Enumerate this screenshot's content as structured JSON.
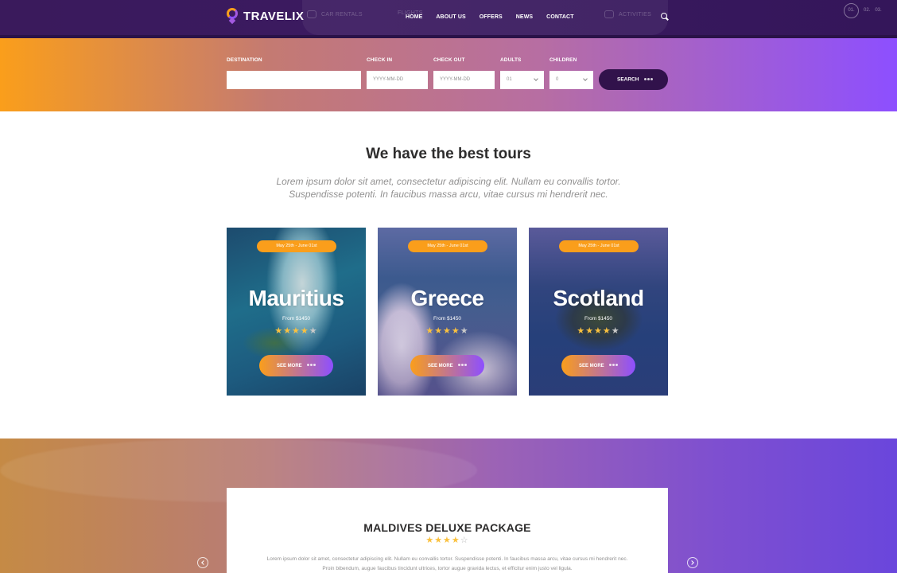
{
  "header": {
    "logo_text": "TRAVELIX",
    "ghost_tabs": [
      "CAR RENTALS",
      "FLIGHTS",
      "ACTIVITIES"
    ],
    "nav": [
      "HOME",
      "ABOUT US",
      "OFFERS",
      "NEWS",
      "CONTACT"
    ],
    "slider_pages": [
      "01.",
      "02.",
      "03."
    ]
  },
  "search": {
    "destination_label": "DESTINATION",
    "destination_value": "",
    "checkin_label": "CHECK IN",
    "checkin_placeholder": "YYYY-MM-DD",
    "checkout_label": "CHECK OUT",
    "checkout_placeholder": "YYYY-MM-DD",
    "adults_label": "ADULTS",
    "adults_value": "01",
    "children_label": "CHILDREN",
    "children_value": "0",
    "button_label": "SEARCH"
  },
  "tours": {
    "title": "We have the best tours",
    "subtitle": "Lorem ipsum dolor sit amet, consectetur adipiscing elit. Nullam eu convallis tortor. Suspendisse potenti. In faucibus massa arcu, vitae cursus mi hendrerit nec.",
    "cards": [
      {
        "date": "May 25th - June 01st",
        "name": "Mauritius",
        "price": "From $1450",
        "rating": 4,
        "button": "SEE MORE"
      },
      {
        "date": "May 25th - June 01st",
        "name": "Greece",
        "price": "From $1450",
        "rating": 4,
        "button": "SEE MORE"
      },
      {
        "date": "May 25th - June 01st",
        "name": "Scotland",
        "price": "From $1450",
        "rating": 4,
        "button": "SEE MORE"
      }
    ]
  },
  "offer": {
    "title": "MALDIVES DELUXE PACKAGE",
    "rating": 4,
    "text": "Lorem ipsum dolor sit amet, consectetur adipiscing elit. Nullam eu convallis tortor. Suspendisse potenti. In faucibus massa arcu, vitae cursus mi hendrerit nec. Proin bibendum, augue faucibus tincidunt ultrices, tortor augue gravida lectus, et efficitur enim justo vel ligula."
  },
  "colors": {
    "accent_orange": "#fa9e1b",
    "accent_purple": "#8d4fff",
    "dark_purple": "#31124b",
    "star": "#fac13f"
  }
}
